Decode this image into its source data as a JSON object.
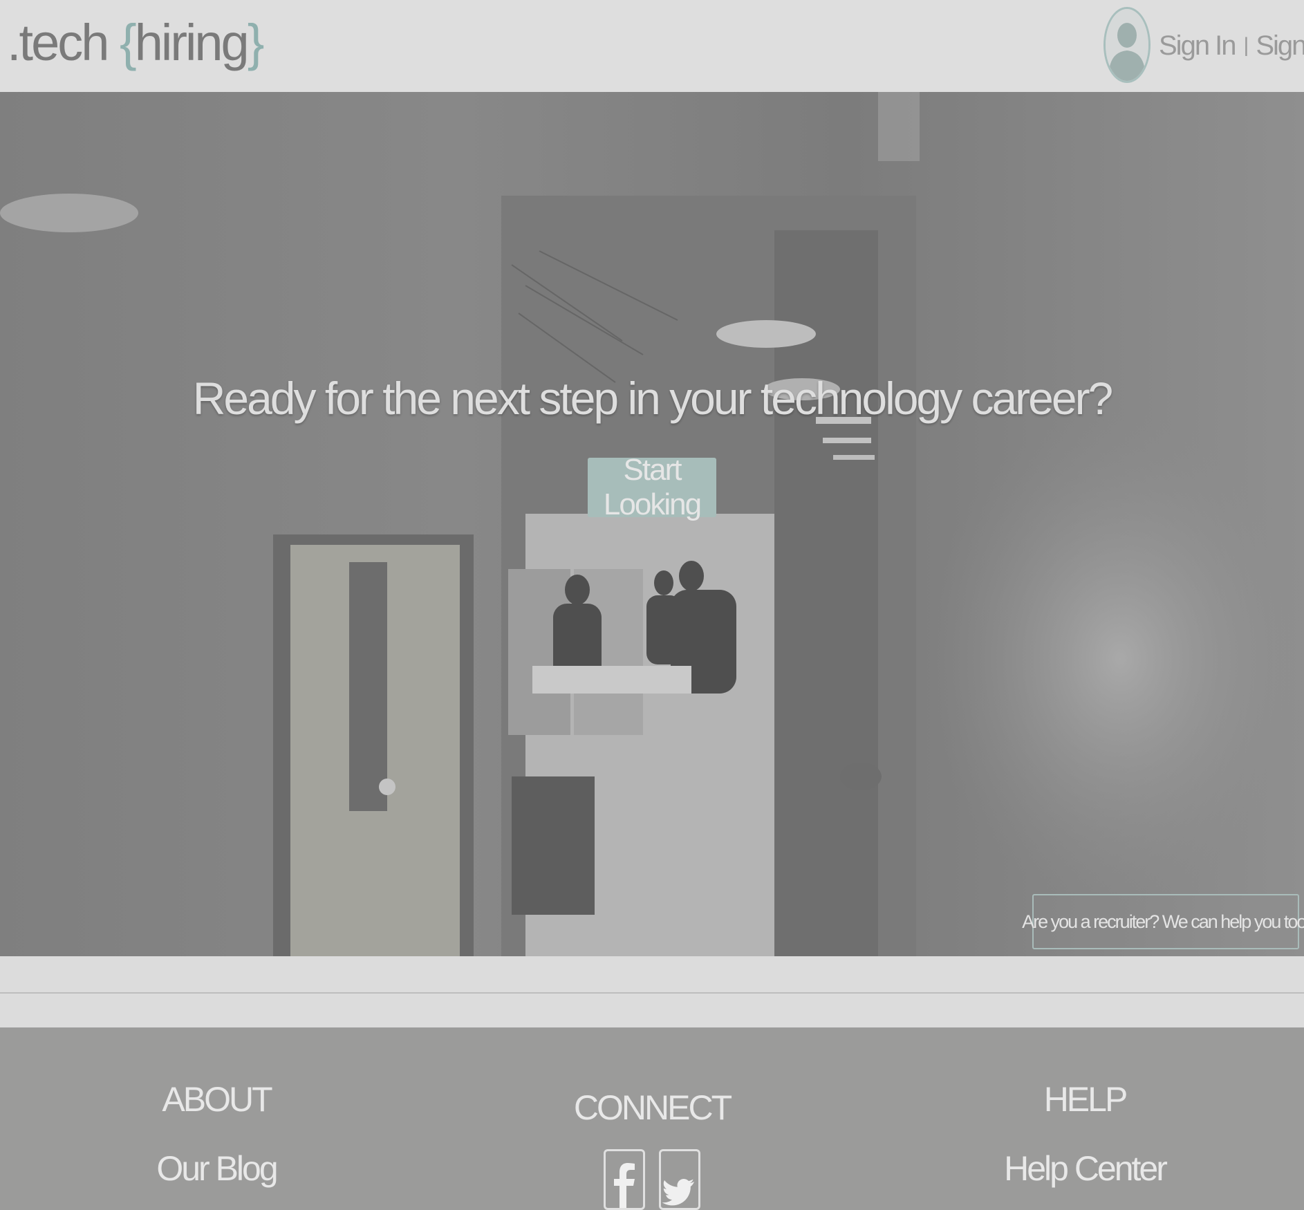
{
  "header": {
    "logo": {
      "prefix": ".tech ",
      "brace_open": "{",
      "word": "hiring",
      "brace_close": "}"
    },
    "avatar_icon": "user-silhouette-icon",
    "sign_in": "Sign In",
    "separator": "|",
    "sign_up": "Sign Up"
  },
  "hero": {
    "title": "Ready for the next step in your technology career?",
    "cta": "Start Looking",
    "recruiter_link": "Are you a recruiter? We can help you too."
  },
  "footer": {
    "about": {
      "heading": "ABOUT",
      "link": "Our Blog"
    },
    "connect": {
      "heading": "CONNECT",
      "icons": [
        "facebook-icon",
        "twitter-icon"
      ]
    },
    "help": {
      "heading": "HELP",
      "link": "Help Center"
    }
  },
  "colors": {
    "accent": "#a7bdba",
    "header_bg": "#dedede",
    "footer_bg": "#9b9b9a",
    "hero_overlay": "#8e8e8e"
  }
}
